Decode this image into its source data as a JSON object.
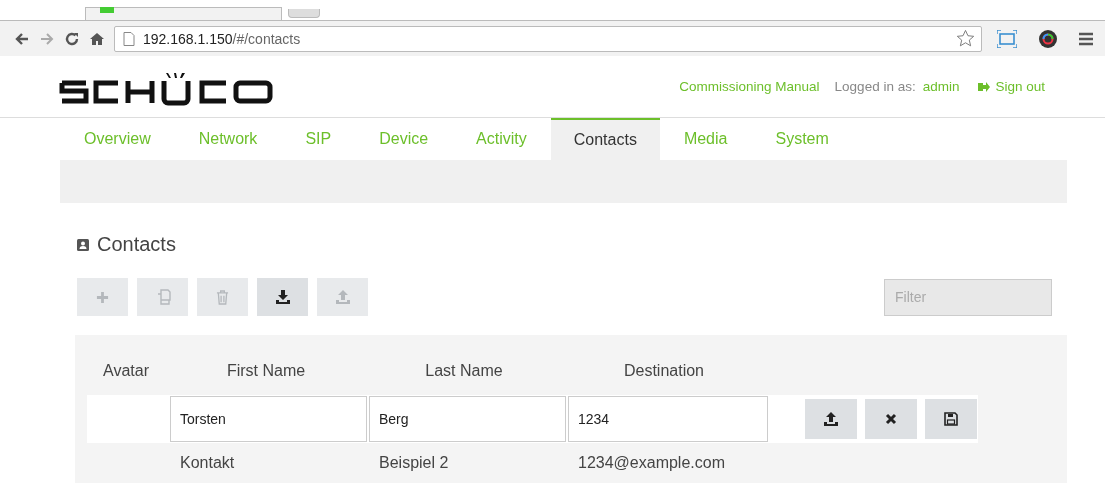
{
  "browser": {
    "url_host": "192.168.1.150",
    "url_path": "/#/contacts"
  },
  "header": {
    "manual_link": "Commissioning Manual",
    "logged_in_label": "Logged in as:",
    "user": "admin",
    "sign_out": "Sign out"
  },
  "tabs": [
    {
      "label": "Overview",
      "selected": false
    },
    {
      "label": "Network",
      "selected": false
    },
    {
      "label": "SIP",
      "selected": false
    },
    {
      "label": "Device",
      "selected": false
    },
    {
      "label": "Activity",
      "selected": false
    },
    {
      "label": "Contacts",
      "selected": true
    },
    {
      "label": "Media",
      "selected": false
    },
    {
      "label": "System",
      "selected": false
    }
  ],
  "section": {
    "title": "Contacts"
  },
  "toolbar": [
    {
      "kind": "add",
      "disabled": true
    },
    {
      "kind": "copy",
      "disabled": true
    },
    {
      "kind": "delete",
      "disabled": true
    },
    {
      "kind": "import",
      "disabled": false
    },
    {
      "kind": "export",
      "disabled": true
    }
  ],
  "filter": {
    "placeholder": "Filter"
  },
  "table": {
    "columns": [
      "Avatar",
      "First Name",
      "Last Name",
      "Destination"
    ],
    "edit_row": {
      "first_name": "Torsten",
      "last_name": "Berg",
      "destination": "1234",
      "actions": [
        {
          "kind": "upload"
        },
        {
          "kind": "cancel"
        },
        {
          "kind": "save"
        }
      ]
    },
    "rows": [
      {
        "first_name": "Kontakt",
        "last_name": "Beispiel 2",
        "destination": "1234@example.com"
      }
    ]
  }
}
